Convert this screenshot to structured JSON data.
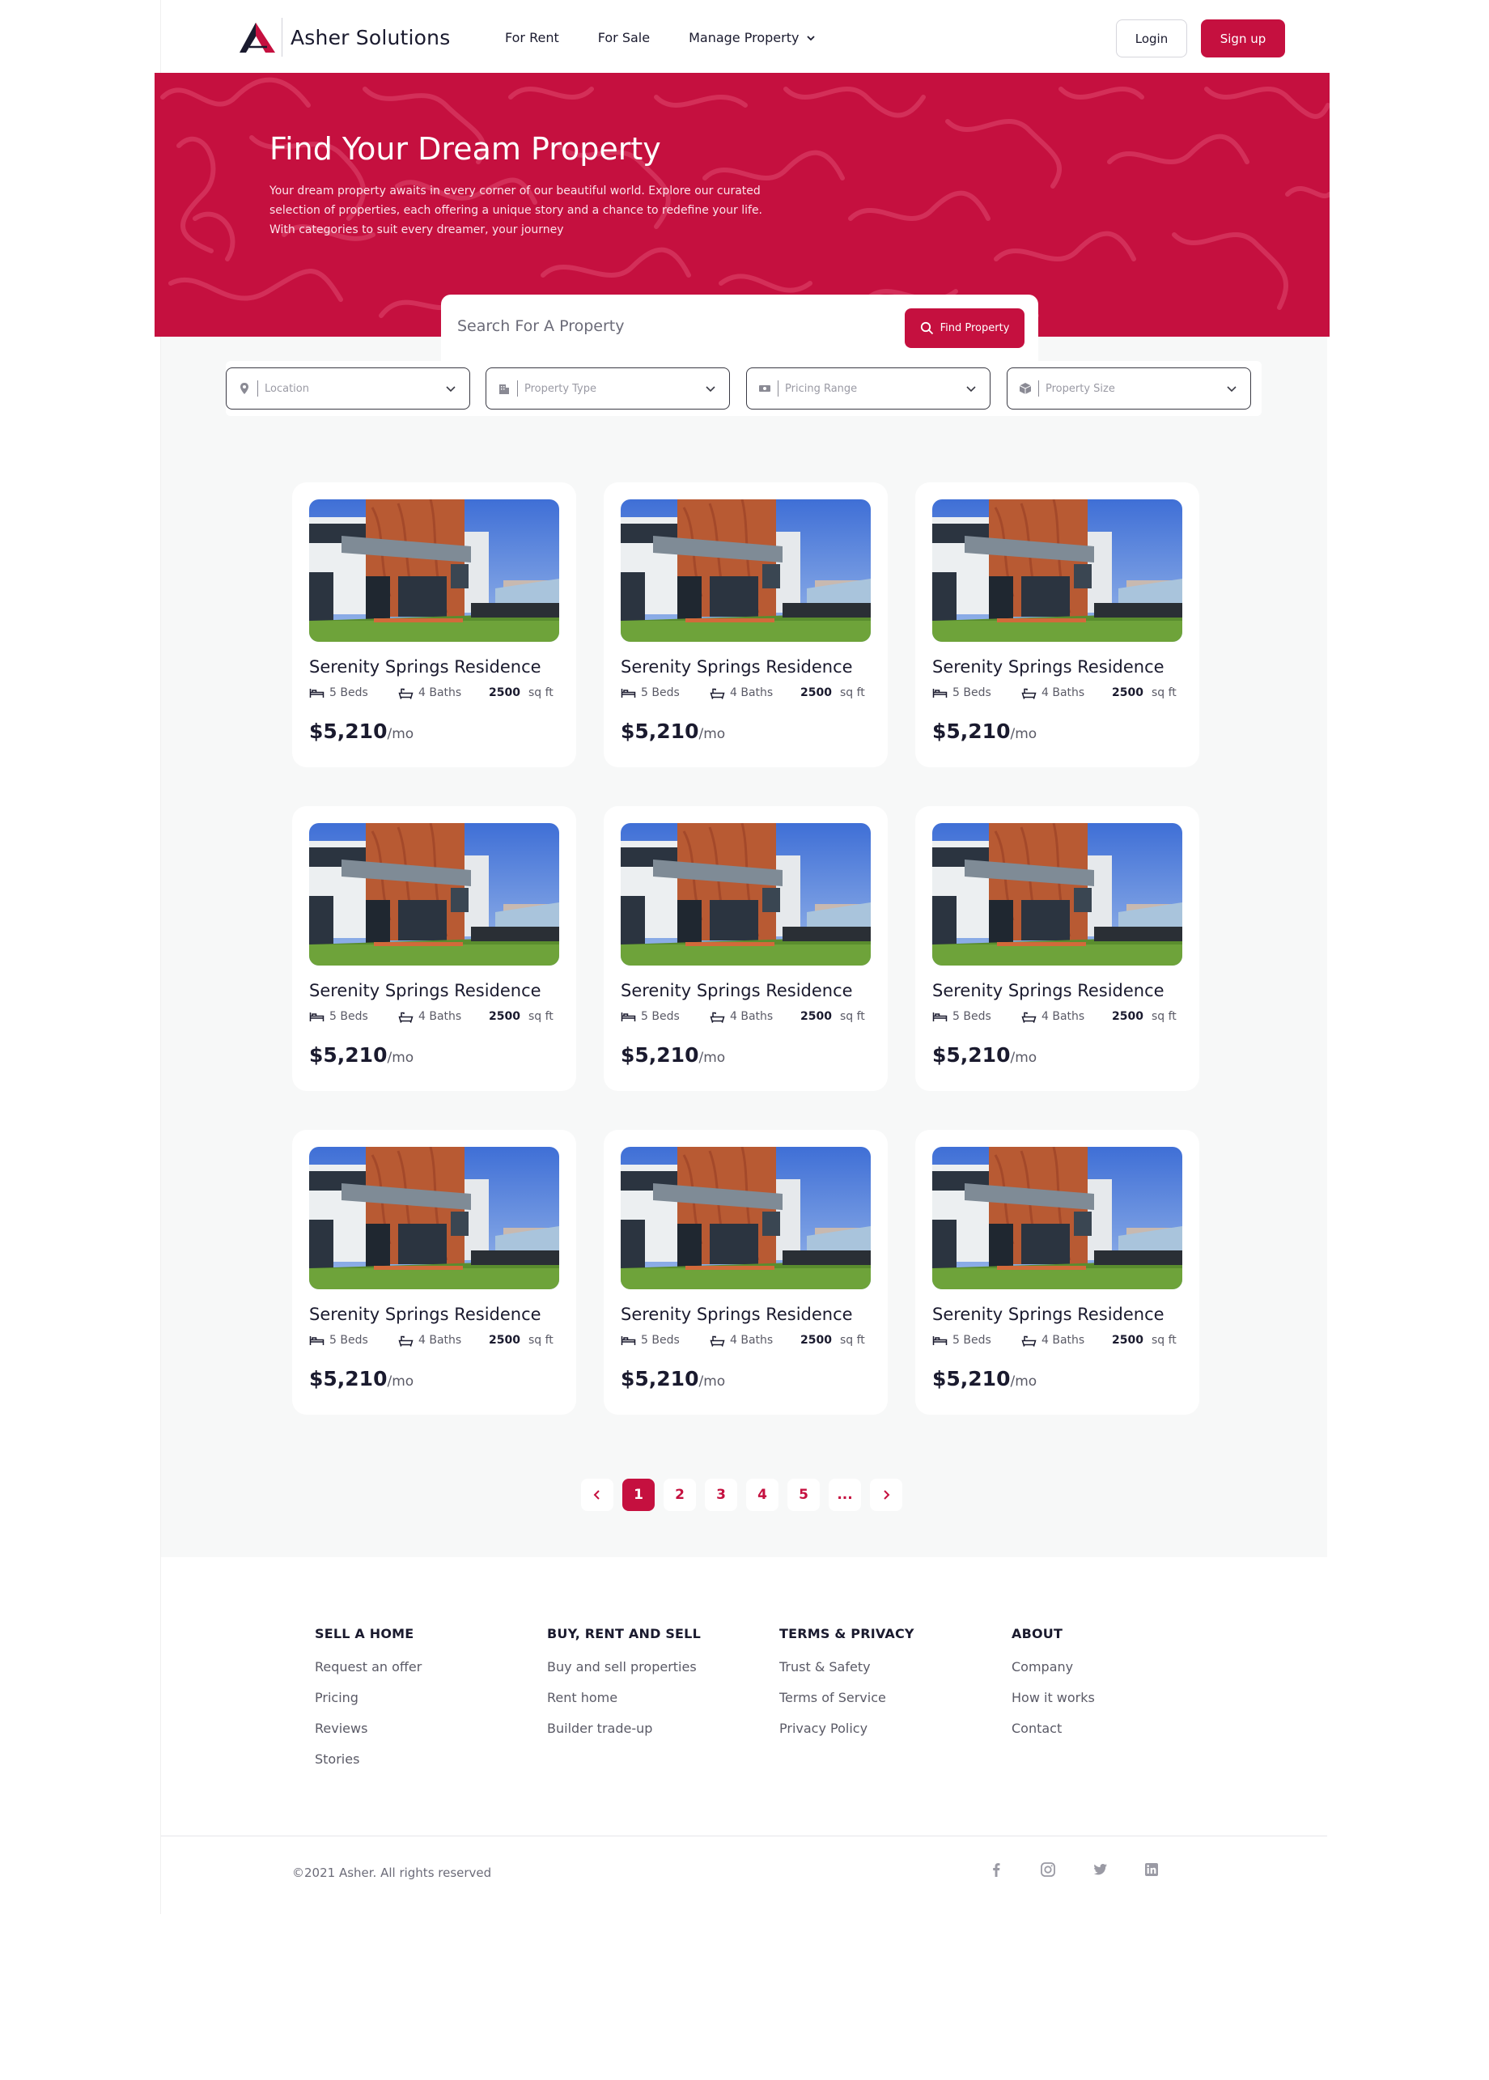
{
  "nav": {
    "brand": "Asher Solutions",
    "links": [
      {
        "label": "For Rent"
      },
      {
        "label": "For Sale"
      },
      {
        "label": "Manage Property"
      }
    ],
    "login_label": "Login",
    "signup_label": "Sign up"
  },
  "hero": {
    "title": "Find Your Dream Property",
    "description": "Your dream property awaits in every corner of our beautiful world. Explore our curated selection of properties, each offering a unique story and a chance to redefine your life. With categories to suit every dreamer, your journey"
  },
  "search": {
    "placeholder": "Search For A Property",
    "button_label": "Find Property"
  },
  "filters": [
    {
      "label": "Location",
      "icon": "location-pin-icon"
    },
    {
      "label": "Property Type",
      "icon": "building-icon"
    },
    {
      "label": "Pricing Range",
      "icon": "money-icon"
    },
    {
      "label": "Property Size",
      "icon": "box-icon"
    }
  ],
  "listings": [
    {
      "title": "Serenity Springs Residence",
      "beds": "5 Beds",
      "baths": "4 Baths",
      "size_value": "2500",
      "size_unit": "sq ft",
      "price": "$5,210",
      "price_period": "/mo"
    },
    {
      "title": "Serenity Springs Residence",
      "beds": "5 Beds",
      "baths": "4 Baths",
      "size_value": "2500",
      "size_unit": "sq ft",
      "price": "$5,210",
      "price_period": "/mo"
    },
    {
      "title": "Serenity Springs Residence",
      "beds": "5 Beds",
      "baths": "4 Baths",
      "size_value": "2500",
      "size_unit": "sq ft",
      "price": "$5,210",
      "price_period": "/mo"
    },
    {
      "title": "Serenity Springs Residence",
      "beds": "5 Beds",
      "baths": "4 Baths",
      "size_value": "2500",
      "size_unit": "sq ft",
      "price": "$5,210",
      "price_period": "/mo"
    },
    {
      "title": "Serenity Springs Residence",
      "beds": "5 Beds",
      "baths": "4 Baths",
      "size_value": "2500",
      "size_unit": "sq ft",
      "price": "$5,210",
      "price_period": "/mo"
    },
    {
      "title": "Serenity Springs Residence",
      "beds": "5 Beds",
      "baths": "4 Baths",
      "size_value": "2500",
      "size_unit": "sq ft",
      "price": "$5,210",
      "price_period": "/mo"
    },
    {
      "title": "Serenity Springs Residence",
      "beds": "5 Beds",
      "baths": "4 Baths",
      "size_value": "2500",
      "size_unit": "sq ft",
      "price": "$5,210",
      "price_period": "/mo"
    },
    {
      "title": "Serenity Springs Residence",
      "beds": "5 Beds",
      "baths": "4 Baths",
      "size_value": "2500",
      "size_unit": "sq ft",
      "price": "$5,210",
      "price_period": "/mo"
    },
    {
      "title": "Serenity Springs Residence",
      "beds": "5 Beds",
      "baths": "4 Baths",
      "size_value": "2500",
      "size_unit": "sq ft",
      "price": "$5,210",
      "price_period": "/mo"
    }
  ],
  "pagination": {
    "pages": [
      "1",
      "2",
      "3",
      "4",
      "5",
      "..."
    ],
    "current": "1"
  },
  "footer": {
    "columns": [
      {
        "heading": "SELL A HOME",
        "links": [
          "Request an offer",
          "Pricing",
          "Reviews",
          "Stories"
        ]
      },
      {
        "heading": "BUY, RENT AND SELL",
        "links": [
          "Buy and sell properties",
          "Rent home",
          "Builder trade-up"
        ]
      },
      {
        "heading": "TERMS & PRIVACY",
        "links": [
          "Trust & Safety",
          "Terms of Service",
          "Privacy Policy"
        ]
      },
      {
        "heading": "ABOUT",
        "links": [
          "Company",
          "How it works",
          "Contact"
        ]
      }
    ],
    "copyright": "©2021 Asher. All rights reserved",
    "socials": [
      "facebook-icon",
      "instagram-icon",
      "twitter-icon",
      "linkedin-icon"
    ]
  },
  "colors": {
    "brand": "#c5103f",
    "text": "#1a1a2e",
    "muted": "#5a5a66",
    "background_gray": "#f7f8f8"
  }
}
